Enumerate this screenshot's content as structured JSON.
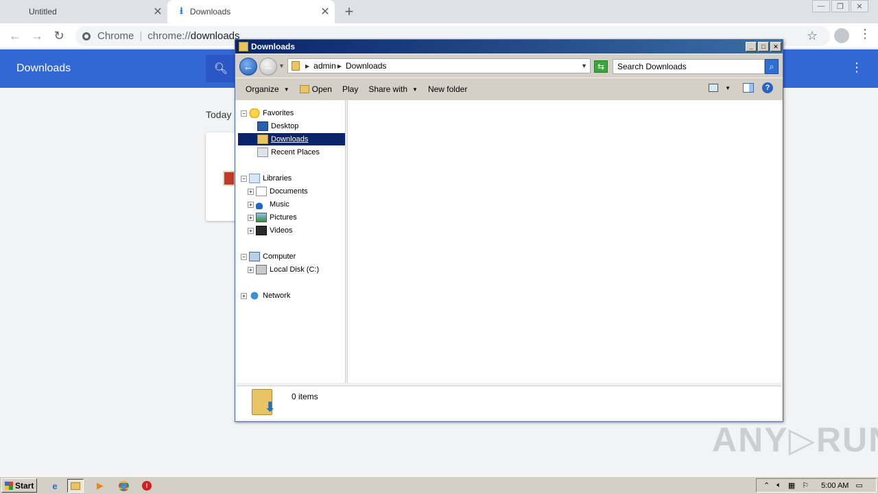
{
  "browser": {
    "tabs": [
      {
        "title": "Untitled",
        "close": "✕"
      },
      {
        "title": "Downloads",
        "close": "✕"
      }
    ],
    "new_tab": "+",
    "window_controls": [
      "—",
      "❐",
      "✕"
    ],
    "omnibox": {
      "scheme_label": "Chrome",
      "url_prefix": "chrome://",
      "url_path": "downloads"
    }
  },
  "downloads_page": {
    "title": "Downloads",
    "section_label": "Today"
  },
  "explorer": {
    "title": "Downloads",
    "title_buttons": [
      "_",
      "□",
      "✕"
    ],
    "breadcrumb": [
      "admin",
      "Downloads"
    ],
    "search_placeholder": "Search Downloads",
    "commands": {
      "organize": "Organize",
      "open": "Open",
      "play": "Play",
      "share_with": "Share with",
      "new_folder": "New folder",
      "help": "?"
    },
    "nav": {
      "favorites": "Favorites",
      "desktop": "Desktop",
      "downloads": "Downloads",
      "recent_places": "Recent Places",
      "libraries": "Libraries",
      "documents": "Documents",
      "music": "Music",
      "pictures": "Pictures",
      "videos": "Videos",
      "computer": "Computer",
      "local_disk": "Local Disk (C:)",
      "network": "Network"
    },
    "status": {
      "item_count": "0 items"
    }
  },
  "watermark": "ANY▷RUN",
  "taskbar": {
    "start_label": "Start",
    "clock": "5:00 AM"
  },
  "colors": {
    "chrome_blue_header": "#3367d6",
    "explorer_title_gradient_start": "#0a246a",
    "explorer_selection": "#0a246a",
    "taskbar": "#d4d0c8"
  }
}
